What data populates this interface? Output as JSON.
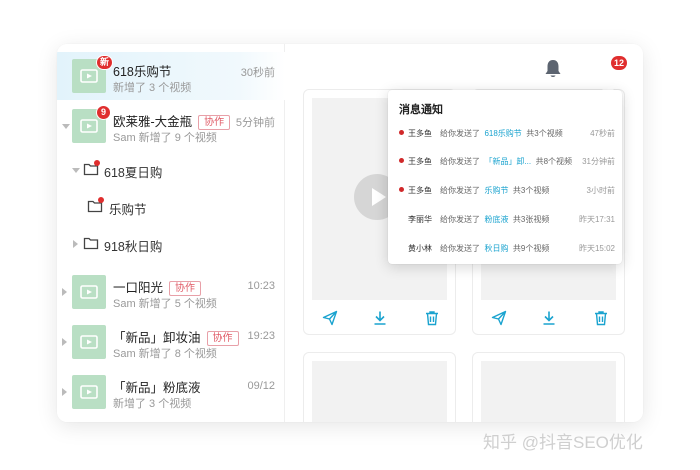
{
  "sidebar": {
    "items": [
      {
        "title": "618乐购节",
        "subtitle": "新增了 3 个视频",
        "time": "30秒前",
        "badge": "新",
        "tag": ""
      },
      {
        "title": "欧莱雅-大金瓶",
        "subtitle": "Sam 新增了 9 个视频",
        "time": "5分钟前",
        "badge": "9",
        "tag": "协作"
      },
      {
        "title": "一口阳光",
        "subtitle": "Sam 新增了 5 个视频",
        "time": "10:23",
        "badge": "",
        "tag": "协作"
      },
      {
        "title": "「新品」卸妆油",
        "subtitle": "Sam 新增了 8 个视频",
        "time": "19:23",
        "badge": "",
        "tag": "协作"
      },
      {
        "title": "「新品」粉底液",
        "subtitle": "新增了 3 个视频",
        "time": "09/12",
        "badge": "",
        "tag": ""
      }
    ],
    "folders": [
      {
        "label": "618夏日购"
      },
      {
        "label": "乐购节"
      },
      {
        "label": "918秋日购"
      }
    ]
  },
  "header": {
    "bell_count": "12"
  },
  "notifications": {
    "title": "消息通知",
    "items": [
      {
        "who": "王多鱼",
        "action": "给你发送了",
        "target": "618乐购节",
        "count": "共3个视频",
        "time": "47秒前"
      },
      {
        "who": "王多鱼",
        "action": "给你发送了",
        "target": "「新品」卸...",
        "count": "共8个视频",
        "time": "31分钟前"
      },
      {
        "who": "王多鱼",
        "action": "给你发送了",
        "target": "乐购节",
        "count": "共3个视频",
        "time": "3小时前"
      },
      {
        "who": "李丽华",
        "action": "给你发送了",
        "target": "粉底液",
        "count": "共3张视频",
        "time": "昨天17:31"
      },
      {
        "who": "黄小林",
        "action": "给你发送了",
        "target": "秋日购",
        "count": "共9个视频",
        "time": "昨天15:02"
      }
    ]
  },
  "watermark": "知乎 @抖音SEO优化",
  "colors": {
    "accent": "#1aa3cf",
    "badge": "#e02e2e",
    "thumb": "#b9dfc4",
    "active_bg": "#e2f3fb"
  }
}
